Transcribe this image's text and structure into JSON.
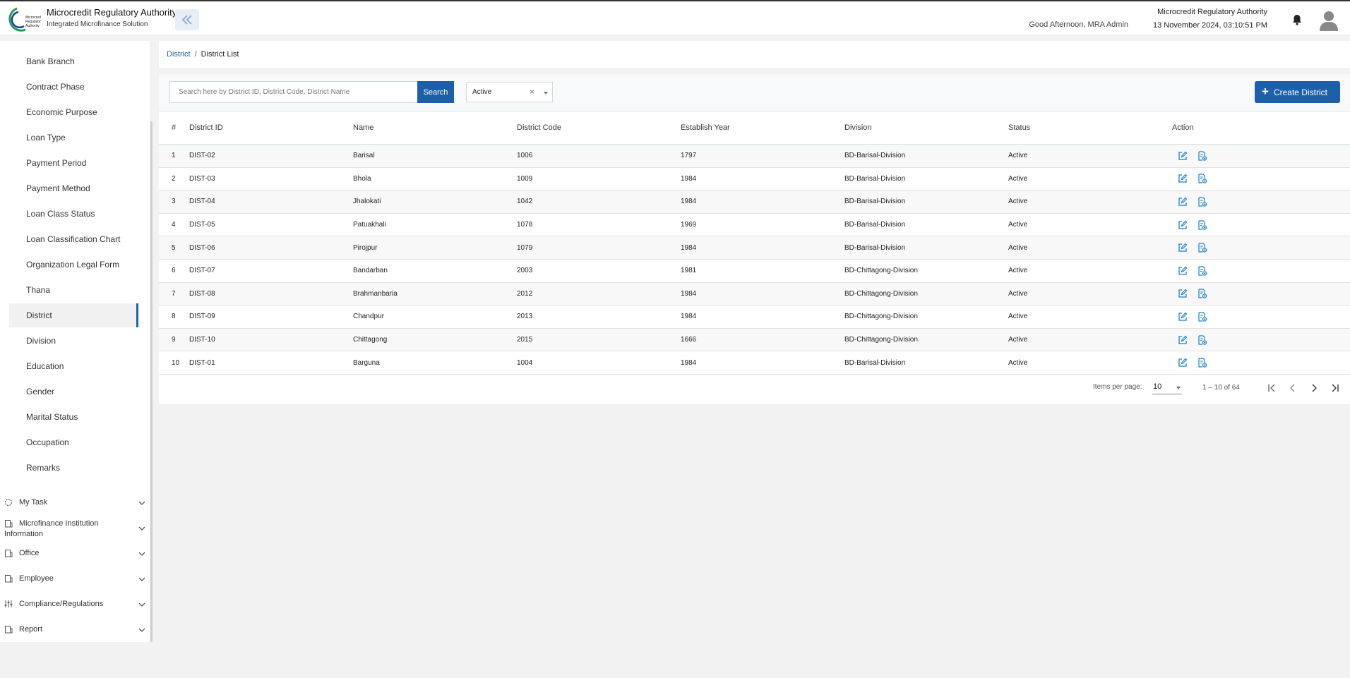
{
  "header": {
    "app_title": "Microcredit Regulatory Authority",
    "app_subtitle": "Integrated Microfinance Solution",
    "logo_text": "Microcredit Regulatory Authority",
    "greeting": "Good Afternoon, MRA Admin",
    "org_name": "Microcredit Regulatory Authority",
    "datetime": "13 November 2024, 03:10:51 PM"
  },
  "sidebar": {
    "items": [
      {
        "label": "Bank Branch"
      },
      {
        "label": "Contract Phase"
      },
      {
        "label": "Economic Purpose"
      },
      {
        "label": "Loan Type"
      },
      {
        "label": "Payment Period"
      },
      {
        "label": "Payment Method"
      },
      {
        "label": "Loan Class Status"
      },
      {
        "label": "Loan Classification Chart"
      },
      {
        "label": "Organization Legal Form"
      },
      {
        "label": "Thana"
      },
      {
        "label": "District"
      },
      {
        "label": "Division"
      },
      {
        "label": "Education"
      },
      {
        "label": "Gender"
      },
      {
        "label": "Marital Status"
      },
      {
        "label": "Occupation"
      },
      {
        "label": "Remarks"
      }
    ],
    "active_item": "District",
    "groups": [
      {
        "label": "My Task",
        "icon": "spinner-icon"
      },
      {
        "label": "Microfinance Institution Information",
        "icon": "building-icon"
      },
      {
        "label": "Office",
        "icon": "building-icon"
      },
      {
        "label": "Employee",
        "icon": "building-icon"
      },
      {
        "label": "Compliance/Regulations",
        "icon": "sliders-icon"
      },
      {
        "label": "Report",
        "icon": "building-icon"
      }
    ]
  },
  "breadcrumb": {
    "parent": "District",
    "separator": "/",
    "current": "District List"
  },
  "toolbar": {
    "search_placeholder": "Search here by District ID, District Code, District Name",
    "search_value": "",
    "search_label": "Search",
    "status_value": "Active",
    "status_clear": "×",
    "create_label": "Create District"
  },
  "table": {
    "headers": [
      "#",
      "District ID",
      "Name",
      "District Code",
      "Establish Year",
      "Division",
      "Status",
      "Action"
    ],
    "rows": [
      {
        "n": "1",
        "id": "DIST-02",
        "name": "Barisal",
        "code": "1006",
        "year": "1797",
        "division": "BD-Barisal-Division",
        "status": "Active"
      },
      {
        "n": "2",
        "id": "DIST-03",
        "name": "Bhola",
        "code": "1009",
        "year": "1984",
        "division": "BD-Barisal-Division",
        "status": "Active"
      },
      {
        "n": "3",
        "id": "DIST-04",
        "name": "Jhalokati",
        "code": "1042",
        "year": "1984",
        "division": "BD-Barisal-Division",
        "status": "Active"
      },
      {
        "n": "4",
        "id": "DIST-05",
        "name": "Patuakhali",
        "code": "1078",
        "year": "1969",
        "division": "BD-Barisal-Division",
        "status": "Active"
      },
      {
        "n": "5",
        "id": "DIST-06",
        "name": "Pirojpur",
        "code": "1079",
        "year": "1984",
        "division": "BD-Barisal-Division",
        "status": "Active"
      },
      {
        "n": "6",
        "id": "DIST-07",
        "name": "Bandarban",
        "code": "2003",
        "year": "1981",
        "division": "BD-Chittagong-Division",
        "status": "Active"
      },
      {
        "n": "7",
        "id": "DIST-08",
        "name": "Brahmanbaria",
        "code": "2012",
        "year": "1984",
        "division": "BD-Chittagong-Division",
        "status": "Active"
      },
      {
        "n": "8",
        "id": "DIST-09",
        "name": "Chandpur",
        "code": "2013",
        "year": "1984",
        "division": "BD-Chittagong-Division",
        "status": "Active"
      },
      {
        "n": "9",
        "id": "DIST-10",
        "name": "Chittagong",
        "code": "2015",
        "year": "1666",
        "division": "BD-Chittagong-Division",
        "status": "Active"
      },
      {
        "n": "10",
        "id": "DIST-01",
        "name": "Barguna",
        "code": "1004",
        "year": "1984",
        "division": "BD-Barisal-Division",
        "status": "Active"
      }
    ]
  },
  "pagination": {
    "items_per_page_label": "Items per page:",
    "items_per_page": "10",
    "range": "1 – 10 of 64"
  },
  "colors": {
    "primary": "#1d5fa8",
    "active_status": "#1a9a1a",
    "action_icon": "#1e7fc9"
  }
}
